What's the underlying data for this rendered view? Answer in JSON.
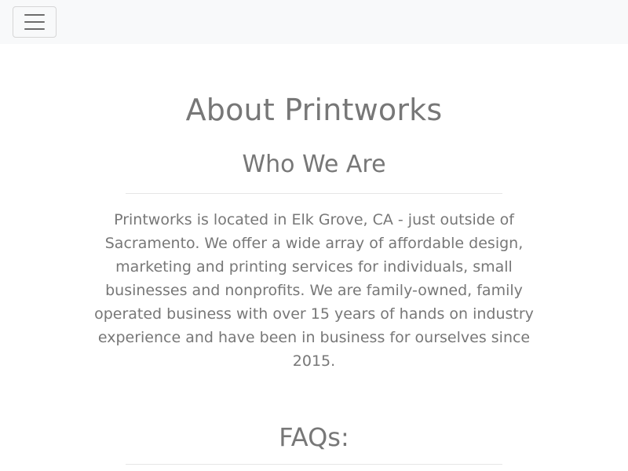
{
  "navbar": {
    "toggler_icon": "hamburger-menu-icon"
  },
  "main": {
    "title": "About Printworks",
    "who_heading": "Who We Are",
    "about_text": "Printworks is located in Elk Grove, CA - just outside of Sacramento. We offer a wide array of affordable design, marketing and printing services for individuals, small businesses and nonprofits. We are family-owned, family operated business with over 15 years of hands on industry experience and have been in business for ourselves since 2015.",
    "faq_heading": "FAQs:"
  }
}
